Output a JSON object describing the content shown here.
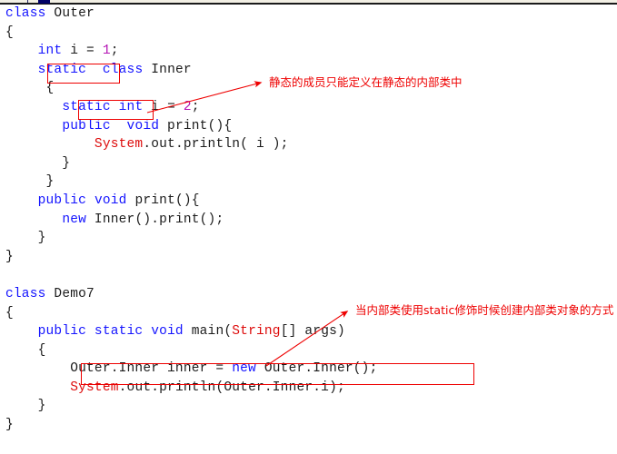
{
  "topbar": {
    "marker_name": "navy-position-marker",
    "tick_name": "ruler-tick"
  },
  "colors": {
    "keyword": "#1414ff",
    "type": "#dd0b0b",
    "number": "#b312b3",
    "plain": "#1c1c1c",
    "annotation": "#ee0000",
    "background": "#ffffff",
    "marker": "#000066"
  },
  "code": {
    "lines": [
      [
        {
          "t": "class ",
          "c": "kw"
        },
        {
          "t": "Outer",
          "c": "pl"
        }
      ],
      [
        {
          "t": "{",
          "c": "pl"
        }
      ],
      [
        {
          "t": "    ",
          "c": "pl"
        },
        {
          "t": "int",
          "c": "kw"
        },
        {
          "t": " i = ",
          "c": "pl"
        },
        {
          "t": "1",
          "c": "num"
        },
        {
          "t": ";",
          "c": "pl"
        }
      ],
      [
        {
          "t": "    ",
          "c": "pl"
        },
        {
          "t": "static",
          "c": "kw"
        },
        {
          "t": "  ",
          "c": "pl"
        },
        {
          "t": "class",
          "c": "kw"
        },
        {
          "t": " Inner",
          "c": "pl"
        }
      ],
      [
        {
          "t": "     {",
          "c": "pl"
        }
      ],
      [
        {
          "t": "       ",
          "c": "pl"
        },
        {
          "t": "static",
          "c": "kw"
        },
        {
          "t": " ",
          "c": "pl"
        },
        {
          "t": "int",
          "c": "kw"
        },
        {
          "t": " i = ",
          "c": "pl"
        },
        {
          "t": "2",
          "c": "num"
        },
        {
          "t": ";",
          "c": "pl"
        }
      ],
      [
        {
          "t": "       ",
          "c": "pl"
        },
        {
          "t": "public",
          "c": "kw"
        },
        {
          "t": "  ",
          "c": "pl"
        },
        {
          "t": "void",
          "c": "kw"
        },
        {
          "t": " print(){",
          "c": "pl"
        }
      ],
      [
        {
          "t": "           ",
          "c": "pl"
        },
        {
          "t": "System",
          "c": "typ"
        },
        {
          "t": ".out.println( i );",
          "c": "pl"
        }
      ],
      [
        {
          "t": "       }",
          "c": "pl"
        }
      ],
      [
        {
          "t": "     }",
          "c": "pl"
        }
      ],
      [
        {
          "t": "    ",
          "c": "pl"
        },
        {
          "t": "public",
          "c": "kw"
        },
        {
          "t": " ",
          "c": "pl"
        },
        {
          "t": "void",
          "c": "kw"
        },
        {
          "t": " print(){",
          "c": "pl"
        }
      ],
      [
        {
          "t": "       ",
          "c": "pl"
        },
        {
          "t": "new",
          "c": "kw"
        },
        {
          "t": " Inner().print();",
          "c": "pl"
        }
      ],
      [
        {
          "t": "    }",
          "c": "pl"
        }
      ],
      [
        {
          "t": "}",
          "c": "pl"
        }
      ],
      [
        {
          "t": "",
          "c": "pl"
        }
      ],
      [
        {
          "t": "class ",
          "c": "kw"
        },
        {
          "t": "Demo7",
          "c": "pl"
        }
      ],
      [
        {
          "t": "{",
          "c": "pl"
        }
      ],
      [
        {
          "t": "    ",
          "c": "pl"
        },
        {
          "t": "public static void",
          "c": "kw"
        },
        {
          "t": " main(",
          "c": "pl"
        },
        {
          "t": "String",
          "c": "typ"
        },
        {
          "t": "[] args)",
          "c": "pl"
        }
      ],
      [
        {
          "t": "    {",
          "c": "pl"
        }
      ],
      [
        {
          "t": "        Outer.Inner inner = ",
          "c": "pl"
        },
        {
          "t": "new",
          "c": "kw"
        },
        {
          "t": " Outer.Inner();",
          "c": "pl"
        }
      ],
      [
        {
          "t": "        ",
          "c": "pl"
        },
        {
          "t": "System",
          "c": "typ"
        },
        {
          "t": ".out.println(Outer.Inner.i);",
          "c": "pl"
        }
      ],
      [
        {
          "t": "    }",
          "c": "pl"
        }
      ],
      [
        {
          "t": "}",
          "c": "pl"
        }
      ]
    ]
  },
  "annotations": {
    "note_1": "静态的成员只能定义在静态的内部类中",
    "note_2": "当内部类使用static修饰时候创建内部类对象的方式"
  },
  "highlight_boxes": [
    {
      "name": "static-class-modifier-box"
    },
    {
      "name": "static-field-modifier-box"
    },
    {
      "name": "outer-inner-instantiation-box"
    }
  ]
}
